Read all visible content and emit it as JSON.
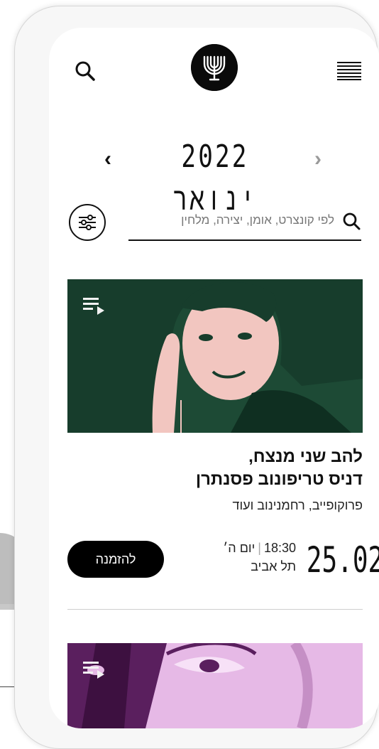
{
  "header": {
    "search_icon": "search-icon",
    "logo_icon": "menorah-logo-icon",
    "menu_icon": "hamburger-menu-icon"
  },
  "month_nav": {
    "title": "2022 ינואר",
    "prev": "‹",
    "next": "›"
  },
  "search": {
    "placeholder": "לפי קונצרט, אומן, יצירה, מלחין",
    "value": ""
  },
  "events": [
    {
      "title_line1": "להב שני מנצח,",
      "title_line2": "דניס טריפונוב פסנתרן",
      "subtitle": "פרוקופייב, רחמנינוב ועוד",
      "date": "25.02",
      "time": "18:30",
      "day": "יום ה׳",
      "city": "תל אביב",
      "book_label": "להזמנה",
      "image_colors": {
        "bg": "#173d2c",
        "tone": "#f2c6c0"
      }
    },
    {
      "image_colors": {
        "bg": "#e6b9e6",
        "tone": "#5a1f5e"
      }
    }
  ],
  "colors": {
    "accent": "#000000",
    "muted": "#9a9a9a"
  }
}
